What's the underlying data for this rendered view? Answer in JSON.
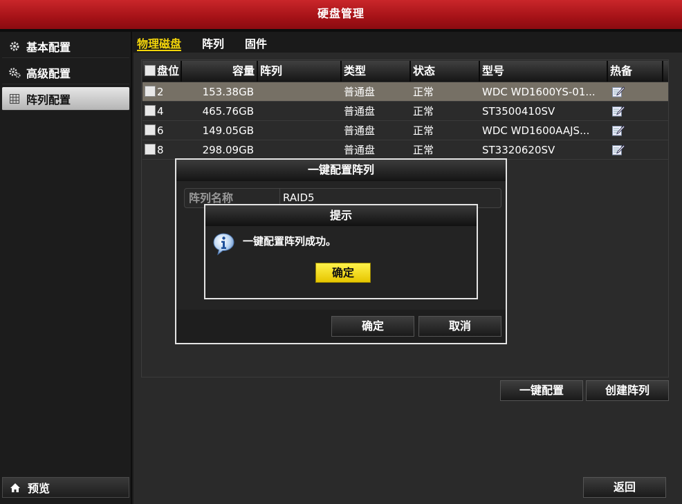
{
  "window": {
    "title": "硬盘管理"
  },
  "sidebar": {
    "items": [
      {
        "label": "基本配置",
        "icon": "gear-icon"
      },
      {
        "label": "高级配置",
        "icon": "gears-icon"
      },
      {
        "label": "阵列配置",
        "icon": "grid-icon",
        "active": true
      }
    ],
    "preview_label": "预览"
  },
  "tabs": [
    {
      "label": "物理磁盘",
      "active": true
    },
    {
      "label": "阵列"
    },
    {
      "label": "固件"
    }
  ],
  "table": {
    "headers": [
      "盘位",
      "容量",
      "阵列",
      "类型",
      "状态",
      "型号",
      "热备"
    ],
    "rows": [
      {
        "slot": "2",
        "capacity": "153.38GB",
        "array": "",
        "type": "普通盘",
        "status": "正常",
        "model": "WDC WD1600YS-01...",
        "selected": true
      },
      {
        "slot": "4",
        "capacity": "465.76GB",
        "array": "",
        "type": "普通盘",
        "status": "正常",
        "model": "ST3500410SV"
      },
      {
        "slot": "6",
        "capacity": "149.05GB",
        "array": "",
        "type": "普通盘",
        "status": "正常",
        "model": "WDC WD1600AAJS..."
      },
      {
        "slot": "8",
        "capacity": "298.09GB",
        "array": "",
        "type": "普通盘",
        "status": "正常",
        "model": "ST3320620SV"
      }
    ]
  },
  "actions": {
    "one_key": "一键配置",
    "create_array": "创建阵列",
    "back": "返回"
  },
  "dialog": {
    "title": "一键配置阵列",
    "field_label": "阵列名称",
    "field_value": "RAID5",
    "ok": "确定",
    "cancel": "取消"
  },
  "message": {
    "title": "提示",
    "text": "一键配置阵列成功。",
    "ok": "确定",
    "icon": "info-icon"
  },
  "colors": {
    "accent": "#f5d60a",
    "titlebar": "#a51217",
    "selected_row": "#767065"
  }
}
